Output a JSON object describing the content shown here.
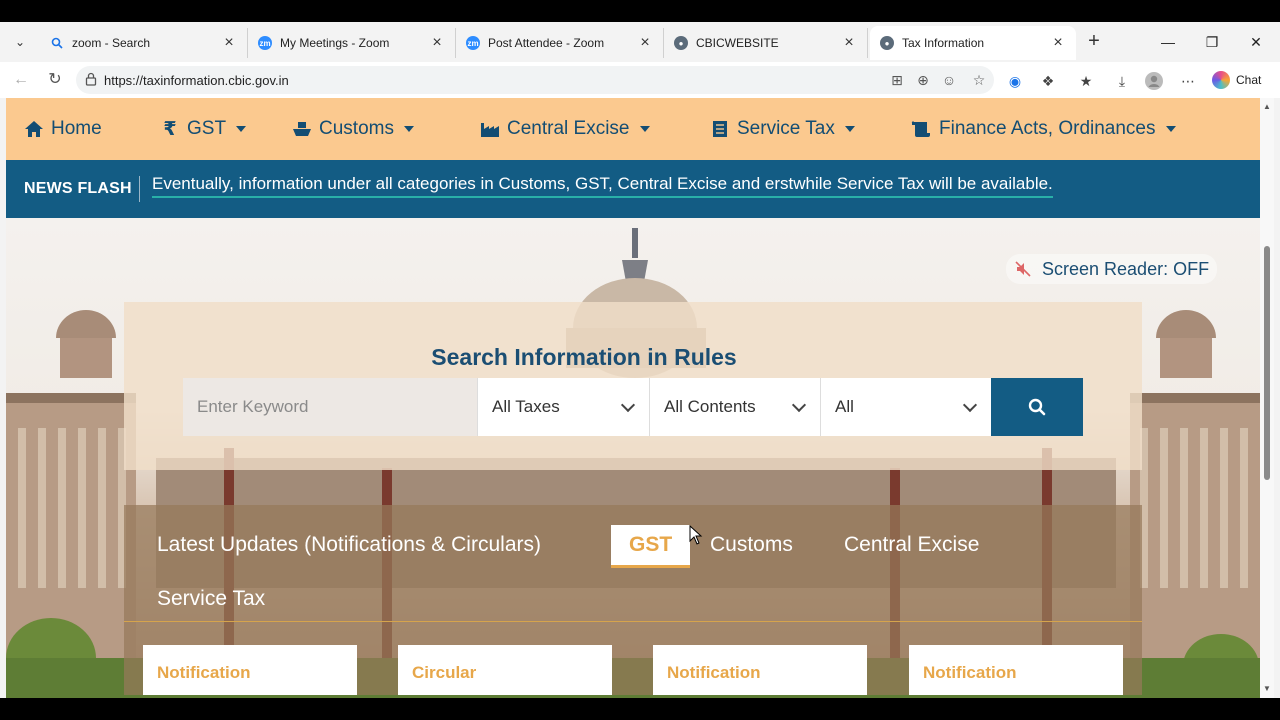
{
  "browser": {
    "tabs": [
      {
        "title": "zoom - Search",
        "icon": "search-icon"
      },
      {
        "title": "My Meetings - Zoom",
        "icon": "zoom-icon"
      },
      {
        "title": "Post Attendee - Zoom",
        "icon": "zoom-icon"
      },
      {
        "title": "CBICWEBSITE",
        "icon": "cbic-emblem-icon"
      },
      {
        "title": "Tax Information",
        "icon": "cbic-emblem-icon",
        "active": true
      }
    ],
    "url": "https://taxinformation.cbic.gov.in",
    "chat_label": "Chat"
  },
  "site": {
    "nav": [
      {
        "label": "Home",
        "icon": "home-icon"
      },
      {
        "label": "GST",
        "icon": "rupee-icon"
      },
      {
        "label": "Customs",
        "icon": "ship-icon"
      },
      {
        "label": "Central Excise",
        "icon": "factory-icon"
      },
      {
        "label": "Service Tax",
        "icon": "document-icon"
      },
      {
        "label": "Finance Acts, Ordinances",
        "icon": "scroll-icon"
      }
    ],
    "news_flash": {
      "label": "NEWS FLASH",
      "text": "Eventually, information under all categories in Customs, GST, Central Excise and erstwhile Service Tax will be available."
    },
    "screen_reader": "Screen Reader: OFF",
    "search": {
      "title": "Search Information in Rules",
      "placeholder": "Enter Keyword",
      "tax_select": "All Taxes",
      "content_select": "All Contents",
      "third_select": "All"
    },
    "updates": {
      "title": "Latest Updates (Notifications & Circulars)",
      "tabs": [
        "GST",
        "Customs",
        "Central Excise",
        "Service Tax"
      ],
      "active_tab": "GST",
      "cards": [
        "Notification",
        "Circular",
        "Notification",
        "Notification"
      ]
    }
  },
  "colors": {
    "nav_bg": "#fbc98f",
    "primary": "#135c84",
    "accent": "#e7a74a"
  }
}
